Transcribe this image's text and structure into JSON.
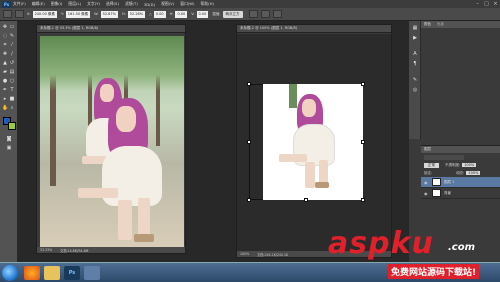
{
  "app": {
    "logo": "Ps"
  },
  "menu": [
    "文件(F)",
    "编辑(E)",
    "图像(I)",
    "图层(L)",
    "文字(Y)",
    "选择(S)",
    "滤镜(T)",
    "3D(D)",
    "视图(V)",
    "窗口(W)",
    "帮助(H)"
  ],
  "window_controls": {
    "minimize": "–",
    "maximize": "□",
    "close": "×"
  },
  "options": {
    "x_label": "X:",
    "x_value": "240.00 像素",
    "y_label": "Y:",
    "y_value": "161.50 像素",
    "w_label": "W:",
    "w_value": "52.67%",
    "h_label": "H:",
    "h_value": "52.28%",
    "angle_label": "△",
    "angle_value": "0.00",
    "hskew_label": "H:",
    "hskew_value": "0.00",
    "vskew_label": "V:",
    "vskew_value": "0.00",
    "interp_label": "插值:",
    "interp_value": "两次立方"
  },
  "doc1": {
    "tab": "未标题-1 @ 33.3% (图层 1, RGB/8)",
    "status_zoom": "33.33%",
    "status_text": "文档:14.8M/34.8M"
  },
  "doc2": {
    "tab": "未标题-2 @ 100% (图层 1, RGB/8)",
    "status_zoom": "100%",
    "status_text": "文档:244.1K/244.1K"
  },
  "panels": {
    "top_tab": "颜色",
    "top_subtab": "色板",
    "layers_tab": "图层",
    "blend_mode": "正常",
    "opacity_label": "不透明度:",
    "opacity_value": "100%",
    "lock_label": "锁定:",
    "fill_label": "填充:",
    "fill_value": "100%",
    "layers": [
      {
        "name": "图层 1"
      },
      {
        "name": "背景"
      }
    ]
  },
  "colors": {
    "foreground": "#1a5fbf",
    "background": "#9acd32",
    "accent": "#e0202a"
  },
  "watermark": {
    "brand": "aspku",
    "suffix": ".com",
    "tagline": "免费网站源码下载站!"
  }
}
